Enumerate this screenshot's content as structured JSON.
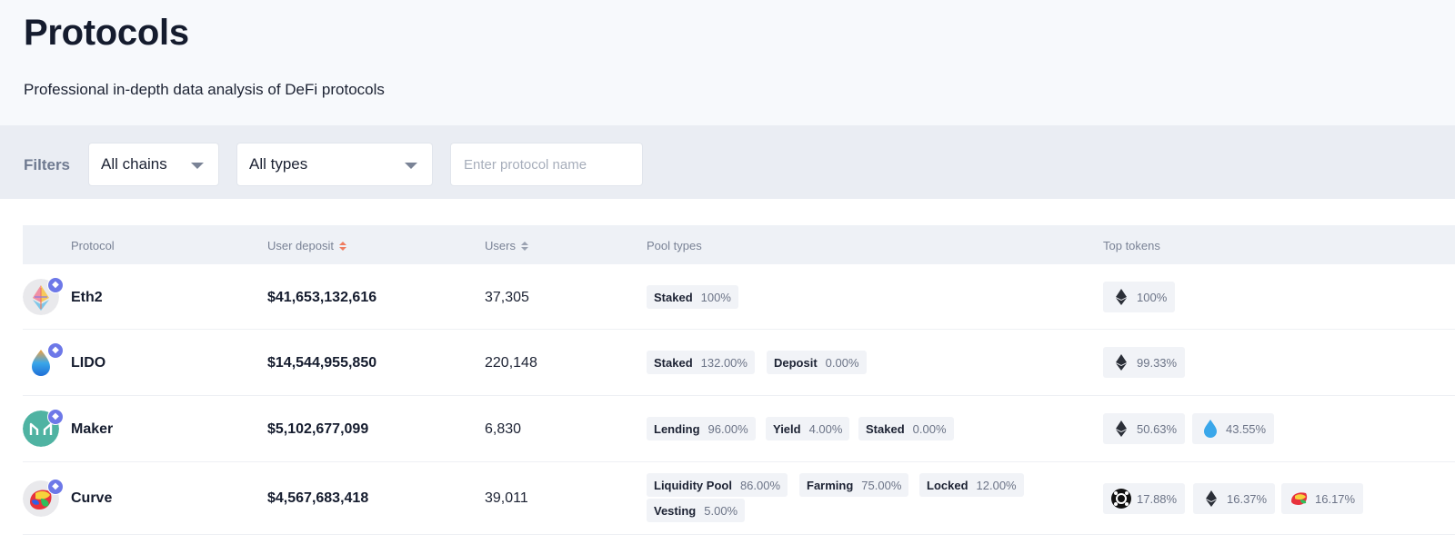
{
  "header": {
    "title": "Protocols",
    "subtitle": "Professional in-depth data analysis of DeFi protocols"
  },
  "filters": {
    "label": "Filters",
    "chain_select": "All chains",
    "type_select": "All types",
    "search_placeholder": "Enter protocol name"
  },
  "table": {
    "columns": {
      "protocol": "Protocol",
      "deposit": "User deposit",
      "users": "Users",
      "pool_types": "Pool types",
      "top_tokens": "Top tokens"
    },
    "rows": [
      {
        "name": "Eth2",
        "icon": "eth2-logo-icon",
        "deposit": "$41,653,132,616",
        "users": "37,305",
        "pools": [
          {
            "label": "Staked",
            "pct": "100%"
          }
        ],
        "tokens": [
          {
            "icon": "eth-icon",
            "pct": "100%"
          }
        ]
      },
      {
        "name": "LIDO",
        "icon": "lido-logo-icon",
        "deposit": "$14,544,955,850",
        "users": "220,148",
        "pools": [
          {
            "label": "Staked",
            "pct": "132.00%"
          },
          {
            "label": "Deposit",
            "pct": "0.00%"
          }
        ],
        "tokens": [
          {
            "icon": "eth-icon",
            "pct": "99.33%"
          }
        ]
      },
      {
        "name": "Maker",
        "icon": "maker-logo-icon",
        "deposit": "$5,102,677,099",
        "users": "6,830",
        "pools": [
          {
            "label": "Lending",
            "pct": "96.00%"
          },
          {
            "label": "Yield",
            "pct": "4.00%"
          },
          {
            "label": "Staked",
            "pct": "0.00%"
          }
        ],
        "tokens": [
          {
            "icon": "eth-icon",
            "pct": "50.63%"
          },
          {
            "icon": "steth-icon",
            "pct": "43.55%"
          }
        ]
      },
      {
        "name": "Curve",
        "icon": "curve-logo-icon",
        "deposit": "$4,567,683,418",
        "users": "39,011",
        "pools": [
          {
            "label": "Liquidity Pool",
            "pct": "86.00%"
          },
          {
            "label": "Farming",
            "pct": "75.00%"
          },
          {
            "label": "Locked",
            "pct": "12.00%"
          },
          {
            "label": "Vesting",
            "pct": "5.00%"
          }
        ],
        "tokens": [
          {
            "icon": "tricrypto-icon",
            "pct": "17.88%"
          },
          {
            "icon": "eth-icon",
            "pct": "16.37%"
          },
          {
            "icon": "crv-icon",
            "pct": "16.17%"
          }
        ]
      }
    ]
  },
  "colors": {
    "sort_active": "#ef7c5f",
    "chain_badge": "#6d78e8",
    "maker_brand": "#4fb3a2"
  }
}
